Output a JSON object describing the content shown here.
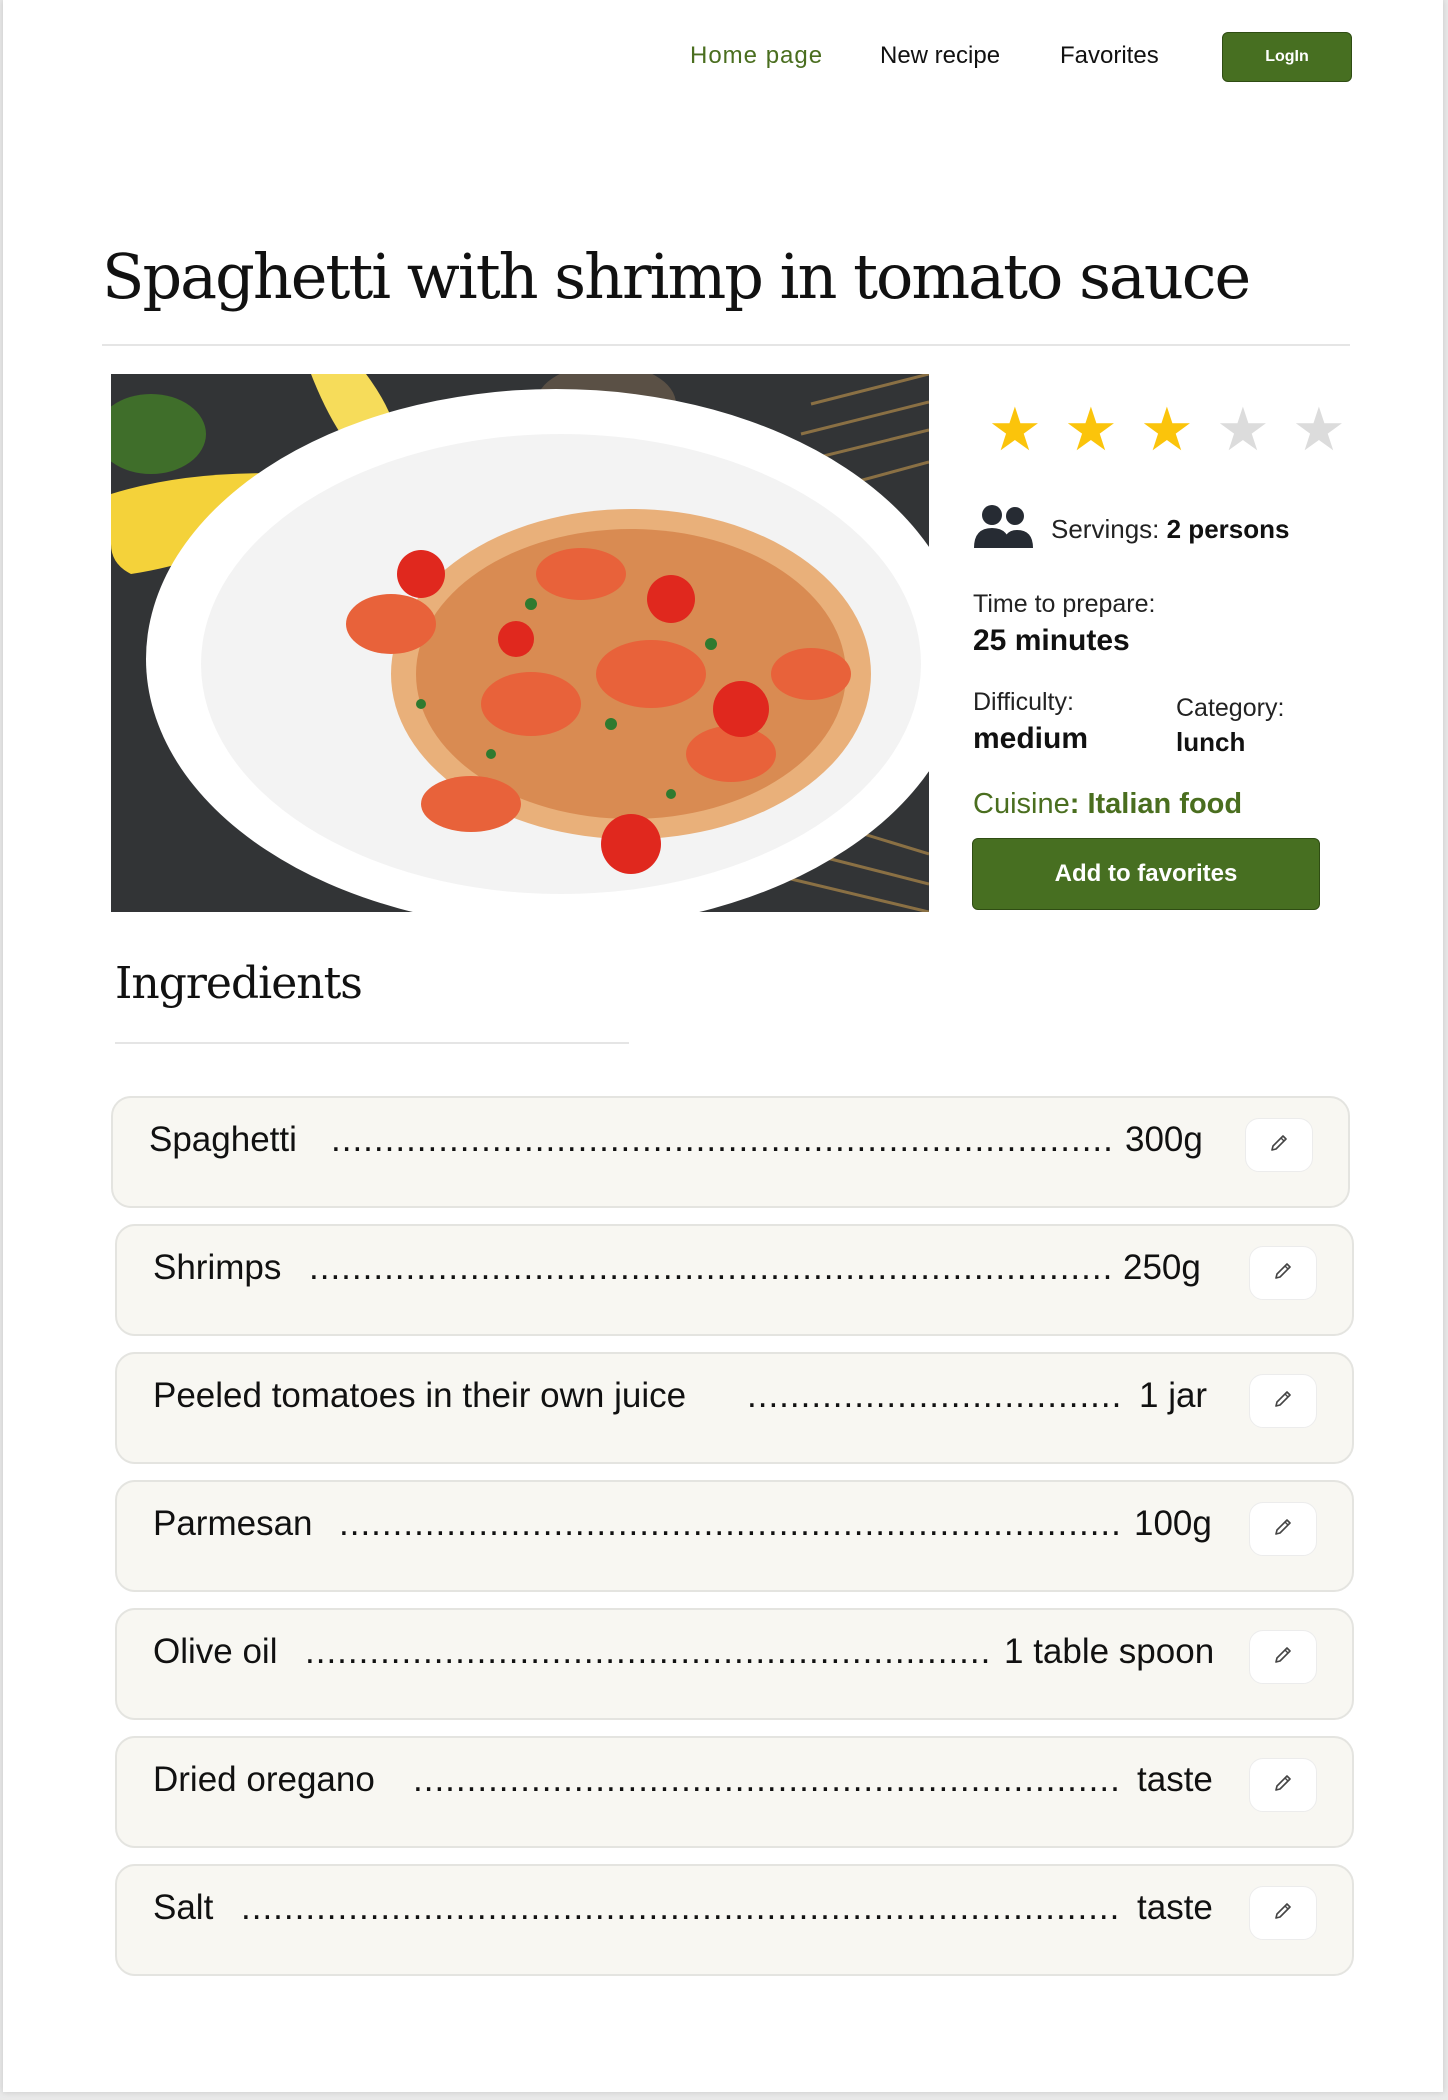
{
  "nav": {
    "home": "Home page",
    "new_recipe": "New recipe",
    "favorites": "Favorites",
    "login": "LogIn"
  },
  "recipe": {
    "title": "Spaghetti with shrimp in tomato sauce",
    "rating": {
      "value": 3,
      "max": 5
    },
    "servings_label": "Servings:",
    "servings_value": "2 persons",
    "time_label": "Time to prepare:",
    "time_value": "25 minutes",
    "difficulty_label": "Difficulty:",
    "difficulty_value": "medium",
    "category_label": "Category:",
    "category_value": "lunch",
    "cuisine_label": "Cuisine",
    "cuisine_sep": ":",
    "cuisine_value": "Italian food",
    "add_favorites": "Add to favorites"
  },
  "ingredients": {
    "title": "Ingredients",
    "items": [
      {
        "name": "Spaghetti",
        "qty": "300g"
      },
      {
        "name": "Shrimps",
        "qty": "250g"
      },
      {
        "name": "Peeled tomatoes in their own juice",
        "qty": "1 jar"
      },
      {
        "name": "Parmesan",
        "qty": "100g"
      },
      {
        "name": "Olive oil",
        "qty": "1 table spoon"
      },
      {
        "name": "Dried oregano",
        "qty": "taste"
      },
      {
        "name": "Salt",
        "qty": "taste"
      }
    ]
  },
  "colors": {
    "accent": "#476f21",
    "star_on": "#fbc40b",
    "star_off": "#dcdcdc",
    "row_bg": "#f8f7f2"
  },
  "icons": {
    "servings": "people-icon",
    "edit": "pencil-icon",
    "star": "star-icon"
  }
}
